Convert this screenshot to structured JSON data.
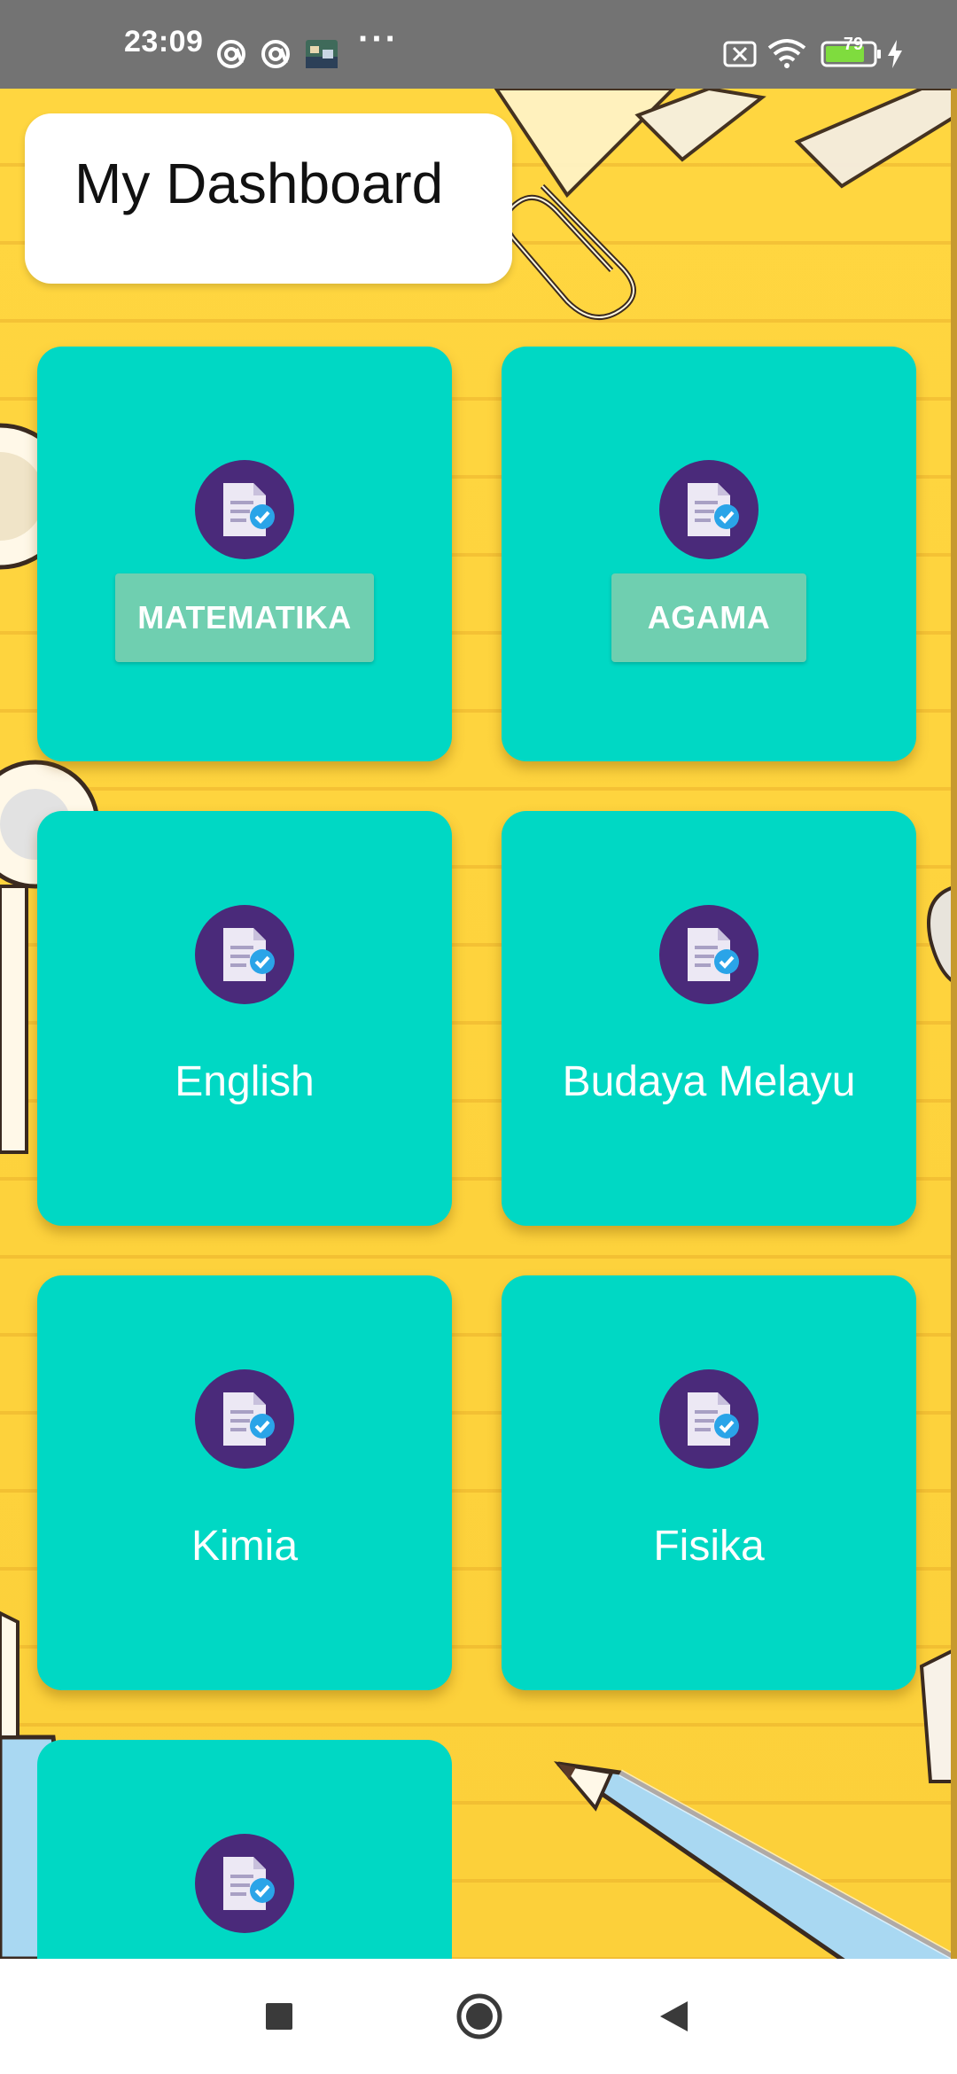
{
  "status_bar": {
    "time": "23:09",
    "icons": [
      "at-sign-icon",
      "at-sign-icon",
      "photo-thumbnail-icon",
      "more-dots-icon",
      "sim-error-icon",
      "wifi-icon",
      "battery-icon",
      "charging-icon"
    ],
    "dots": "···",
    "battery_level": "79",
    "battery_color": "#7fdc3e"
  },
  "header": {
    "title": "My Dashboard"
  },
  "cards": [
    {
      "label": "MATEMATIKA",
      "style": "button",
      "icon": "document-check-icon"
    },
    {
      "label": "AGAMA",
      "style": "button",
      "icon": "document-check-icon"
    },
    {
      "label": "English",
      "style": "text",
      "icon": "document-check-icon"
    },
    {
      "label": "Budaya Melayu",
      "style": "text",
      "icon": "document-check-icon"
    },
    {
      "label": "Kimia",
      "style": "text",
      "icon": "document-check-icon"
    },
    {
      "label": "Fisika",
      "style": "text",
      "icon": "document-check-icon"
    },
    {
      "label": "",
      "style": "text",
      "icon": "document-check-icon"
    }
  ],
  "colors": {
    "card": "#00d8c4",
    "button": "#6fcfb0",
    "icon_circle": "#4a2a7a",
    "background": "#fdd23c"
  },
  "nav_bar": {
    "items": [
      "recents-square-icon",
      "home-circle-icon",
      "back-triangle-icon"
    ]
  }
}
